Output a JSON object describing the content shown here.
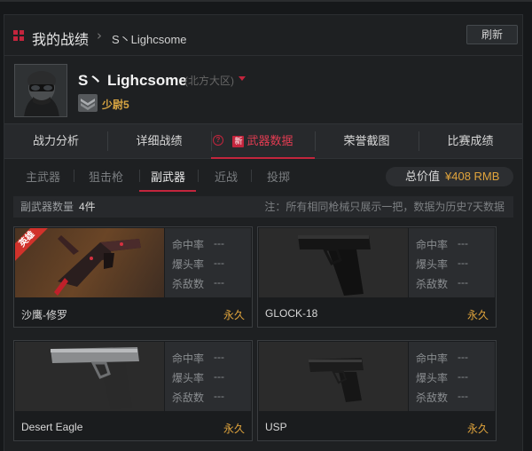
{
  "header": {
    "title": "我的战绩",
    "player_short": "S丶Lighcsome",
    "refresh_label": "刷新"
  },
  "profile": {
    "name": "S丶 Lighcsome",
    "region": "(北方大区)",
    "rank": "少尉5"
  },
  "tabs": [
    {
      "label": "战力分析"
    },
    {
      "label": "详细战绩"
    },
    {
      "label": "武器数据",
      "badge": "新",
      "active": true
    },
    {
      "label": "荣誉截图"
    },
    {
      "label": "比赛成绩"
    }
  ],
  "subtabs": [
    {
      "label": "主武器"
    },
    {
      "label": "狙击枪"
    },
    {
      "label": "副武器",
      "active": true
    },
    {
      "label": "近战"
    },
    {
      "label": "投掷"
    }
  ],
  "total": {
    "label": "总价值",
    "value": "¥408 RMB"
  },
  "info": {
    "count_label": "副武器数量",
    "count_value": "4件",
    "note": "注：所有相同枪械只展示一把，数据为历史7天数据"
  },
  "stat_labels": {
    "hit": "命中率",
    "headshot": "爆头率",
    "kills": "杀敌数"
  },
  "weapons": [
    {
      "name": "沙鹰-修罗",
      "duration": "永久",
      "hit": "---",
      "headshot": "---",
      "kills": "---",
      "tag": "英雄",
      "icon": "desert-eagle-hero-icon"
    },
    {
      "name": "GLOCK-18",
      "duration": "永久",
      "hit": "---",
      "headshot": "---",
      "kills": "---",
      "icon": "glock-pistol-icon"
    },
    {
      "name": "Desert Eagle",
      "duration": "永久",
      "hit": "---",
      "headshot": "---",
      "kills": "---",
      "icon": "desert-eagle-icon"
    },
    {
      "name": "USP",
      "duration": "永久",
      "hit": "---",
      "headshot": "---",
      "kills": "---",
      "icon": "usp-pistol-icon"
    }
  ],
  "colors": {
    "accent": "#c3253d",
    "gold": "#e0a43c",
    "background": "#1e2022"
  }
}
